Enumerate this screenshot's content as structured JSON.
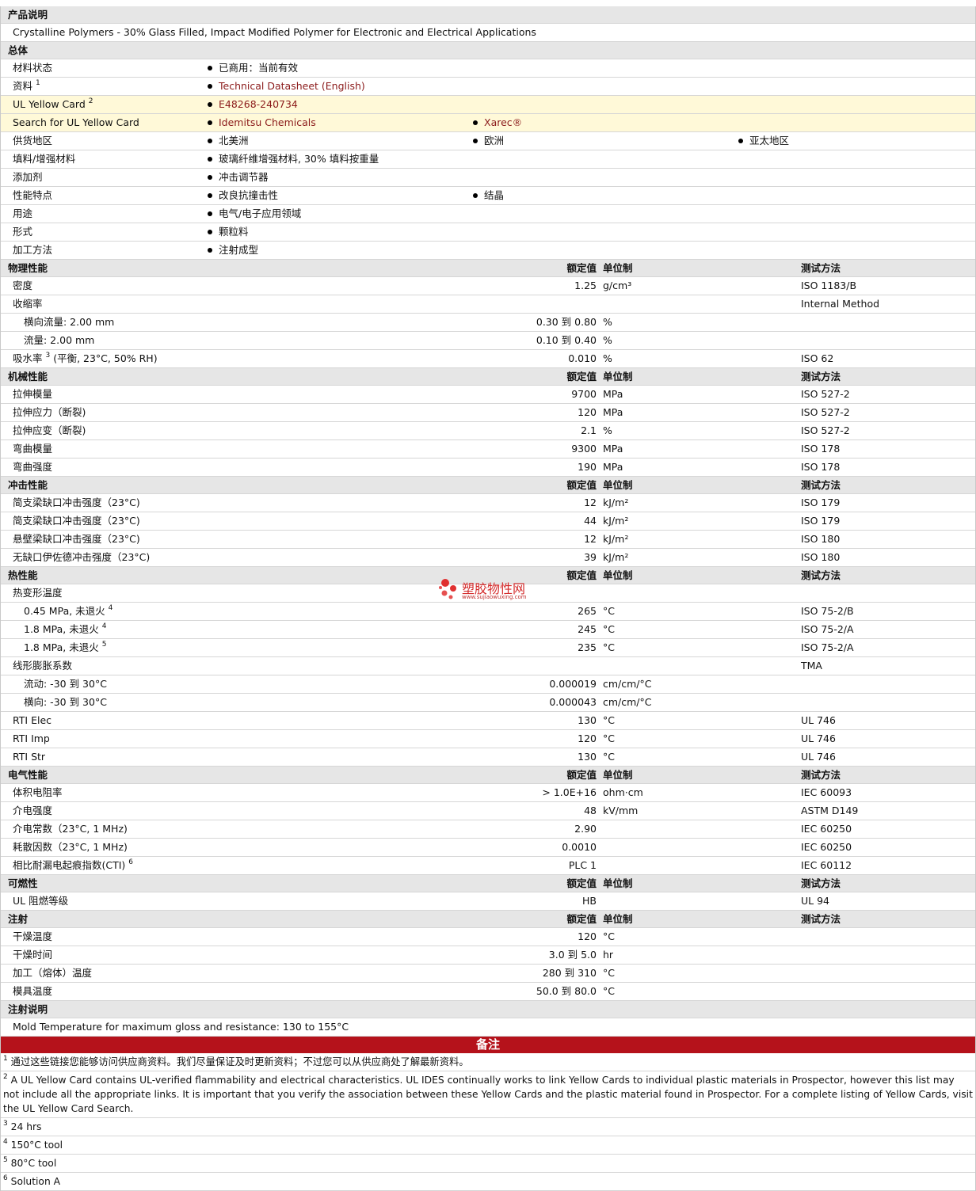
{
  "sections": {
    "product_desc": "产品说明",
    "general": "总体",
    "physical": "物理性能",
    "mechanical": "机械性能",
    "impact": "冲击性能",
    "thermal": "热性能",
    "electrical": "电气性能",
    "flammability": "可燃性",
    "injection": "注射",
    "injection_notes": "注射说明",
    "remarks": "备注"
  },
  "headers": {
    "value": "额定值",
    "unit": "单位制",
    "method": "测试方法"
  },
  "product_description": "Crystalline Polymers - 30% Glass Filled, Impact Modified Polymer for Electronic and Electrical Applications",
  "general": {
    "status_label": "材料状态",
    "status": "已商用：当前有效",
    "docs_label": "资料",
    "docs_sup": "1",
    "docs": "Technical Datasheet (English)",
    "ul_label": "UL Yellow Card",
    "ul_sup": "2",
    "ul": "E48268-240734",
    "search_label": "Search for UL Yellow Card",
    "search1": "Idemitsu Chemicals",
    "search2": "Xarec®",
    "region_label": "供货地区",
    "region1": "北美洲",
    "region2": "欧洲",
    "region3": "亚太地区",
    "filler_label": "填料/增强材料",
    "filler": "玻璃纤维增强材料, 30% 填料按重量",
    "additive_label": "添加剂",
    "additive": "冲击调节器",
    "feature_label": "性能特点",
    "feature1": "改良抗撞击性",
    "feature2": "结晶",
    "use_label": "用途",
    "use": "电气/电子应用领域",
    "form_label": "形式",
    "form": "颗粒料",
    "process_label": "加工方法",
    "process": "注射成型"
  },
  "physical": [
    {
      "label": "密度",
      "value": "1.25",
      "unit": "g/cm³",
      "method": "ISO 1183/B"
    },
    {
      "label": "收缩率",
      "value": "",
      "unit": "",
      "method": "Internal Method"
    },
    {
      "label": "横向流量: 2.00 mm",
      "value": "0.30 到  0.80",
      "unit": "%",
      "method": "",
      "indent": true
    },
    {
      "label": "流量: 2.00 mm",
      "value": "0.10 到  0.40",
      "unit": "%",
      "method": "",
      "indent": true
    },
    {
      "label": "吸水率",
      "sup": "3",
      "label2": " (平衡, 23°C, 50% RH)",
      "value": "0.010",
      "unit": "%",
      "method": "ISO 62"
    }
  ],
  "mechanical": [
    {
      "label": "拉伸模量",
      "value": "9700",
      "unit": "MPa",
      "method": "ISO 527-2"
    },
    {
      "label": "拉伸应力（断裂)",
      "value": "120",
      "unit": "MPa",
      "method": "ISO 527-2"
    },
    {
      "label": "拉伸应变（断裂)",
      "value": "2.1",
      "unit": "%",
      "method": "ISO 527-2"
    },
    {
      "label": "弯曲模量",
      "value": "9300",
      "unit": "MPa",
      "method": "ISO 178"
    },
    {
      "label": "弯曲强度",
      "value": "190",
      "unit": "MPa",
      "method": "ISO 178"
    }
  ],
  "impact": [
    {
      "label": "简支梁缺口冲击强度（23°C)",
      "value": "12",
      "unit": "kJ/m²",
      "method": "ISO 179"
    },
    {
      "label": "简支梁缺口冲击强度（23°C)",
      "value": "44",
      "unit": "kJ/m²",
      "method": "ISO 179"
    },
    {
      "label": "悬壁梁缺口冲击强度（23°C)",
      "value": "12",
      "unit": "kJ/m²",
      "method": "ISO 180"
    },
    {
      "label": "无缺口伊佐德冲击强度（23°C)",
      "value": "39",
      "unit": "kJ/m²",
      "method": "ISO 180"
    }
  ],
  "thermal": [
    {
      "label": "热变形温度",
      "value": "",
      "unit": "",
      "method": ""
    },
    {
      "label": "0.45 MPa, 未退火",
      "sup": "4",
      "value": "265",
      "unit": "°C",
      "method": "ISO 75-2/B",
      "indent": true
    },
    {
      "label": "1.8 MPa, 未退火",
      "sup": "4",
      "value": "245",
      "unit": "°C",
      "method": "ISO 75-2/A",
      "indent": true
    },
    {
      "label": "1.8 MPa, 未退火",
      "sup": "5",
      "value": "235",
      "unit": "°C",
      "method": "ISO 75-2/A",
      "indent": true
    },
    {
      "label": "线形膨胀系数",
      "value": "",
      "unit": "",
      "method": "TMA"
    },
    {
      "label": "流动: -30 到  30°C",
      "value": "0.000019",
      "unit": "cm/cm/°C",
      "method": "",
      "indent": true
    },
    {
      "label": "横向: -30 到  30°C",
      "value": "0.000043",
      "unit": "cm/cm/°C",
      "method": "",
      "indent": true
    },
    {
      "label": "RTI Elec",
      "value": "130",
      "unit": "°C",
      "method": "UL 746"
    },
    {
      "label": "RTI Imp",
      "value": "120",
      "unit": "°C",
      "method": "UL 746"
    },
    {
      "label": "RTI Str",
      "value": "130",
      "unit": "°C",
      "method": "UL 746"
    }
  ],
  "electrical": [
    {
      "label": "体积电阻率",
      "value": "> 1.0E+16",
      "unit": "ohm·cm",
      "method": "IEC 60093"
    },
    {
      "label": "介电强度",
      "value": "48",
      "unit": "kV/mm",
      "method": "ASTM D149"
    },
    {
      "label": "介电常数（23°C, 1 MHz)",
      "value": "2.90",
      "unit": "",
      "method": "IEC 60250"
    },
    {
      "label": "耗散因数（23°C, 1 MHz)",
      "value": "0.0010",
      "unit": "",
      "method": "IEC 60250"
    },
    {
      "label": "相比耐漏电起痕指数(CTI)",
      "sup": "6",
      "value": "PLC 1",
      "unit": "",
      "method": "IEC 60112"
    }
  ],
  "flammability": [
    {
      "label": "UL 阻燃等级",
      "value": "HB",
      "unit": "",
      "method": "UL 94"
    }
  ],
  "injection": [
    {
      "label": "干燥温度",
      "value": "120",
      "unit": "°C",
      "method": ""
    },
    {
      "label": "干燥时间",
      "value": "3.0 到  5.0",
      "unit": "hr",
      "method": ""
    },
    {
      "label": "加工（熔体）温度",
      "value": "280 到  310",
      "unit": "°C",
      "method": ""
    },
    {
      "label": "模具温度",
      "value": "50.0 到  80.0",
      "unit": "°C",
      "method": ""
    }
  ],
  "injection_note": "Mold Temperature for maximum gloss and resistance: 130 to 155°C",
  "notes": [
    {
      "n": "1",
      "text": "通过这些链接您能够访问供应商资料。我们尽量保证及时更新资料；不过您可以从供应商处了解最新资料。"
    },
    {
      "n": "2",
      "text": "A UL Yellow Card contains UL-verified flammability and electrical characteristics. UL IDES continually works to link Yellow Cards to individual plastic materials in Prospector, however this list may not include all the appropriate links. It is important that you verify the association between these Yellow Cards and the plastic material found in Prospector. For a complete listing of Yellow Cards, visit the UL Yellow Card Search."
    },
    {
      "n": "3",
      "text": "24 hrs"
    },
    {
      "n": "4",
      "text": "150°C tool"
    },
    {
      "n": "5",
      "text": "80°C tool"
    },
    {
      "n": "6",
      "text": "Solution A"
    }
  ],
  "watermark": {
    "title": "塑胶物性网",
    "url": "www.sujiaowuxing.com"
  },
  "colors": {
    "section_bg": "#e6e6e6",
    "yellow_bg": "#fff9d8",
    "link": "#8b1a1a",
    "note_header": "#b5121b"
  }
}
